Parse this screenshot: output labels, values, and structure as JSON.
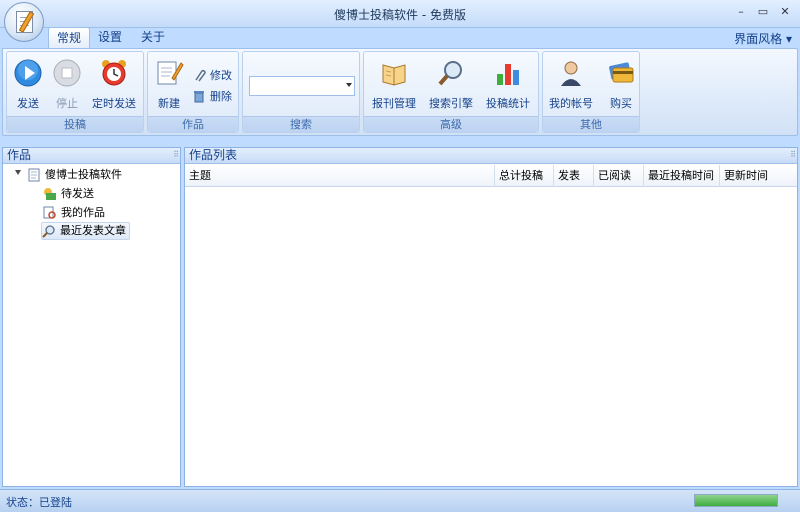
{
  "window": {
    "title": "傻博士投稿软件 - 免费版",
    "controls": {
      "minimize": "–",
      "maximize": "▭",
      "close": "✕"
    }
  },
  "tabs": [
    {
      "label": "常规",
      "active": true
    },
    {
      "label": "设置",
      "active": false
    },
    {
      "label": "关于",
      "active": false
    }
  ],
  "skin_menu": "界面风格 ▾",
  "ribbon": {
    "groups": {
      "submit": {
        "label": "投稿",
        "buttons": [
          {
            "label": "发送",
            "icon": "play-icon",
            "enabled": true
          },
          {
            "label": "停止",
            "icon": "stop-icon",
            "enabled": false
          },
          {
            "label": "定时发送",
            "icon": "alarm-clock-icon",
            "enabled": true
          }
        ]
      },
      "works": {
        "label": "作品",
        "new_label": "新建",
        "edit_label": "修改",
        "delete_label": "删除"
      },
      "search": {
        "label": "搜索",
        "value": ""
      },
      "advanced": {
        "label": "高级",
        "buttons": [
          {
            "label": "报刊管理",
            "icon": "book-icon"
          },
          {
            "label": "搜索引擎",
            "icon": "magnifier-icon"
          },
          {
            "label": "投稿统计",
            "icon": "bar-chart-icon"
          }
        ]
      },
      "other": {
        "label": "其他",
        "buttons": [
          {
            "label": "我的帐号",
            "icon": "user-icon"
          },
          {
            "label": "购买",
            "icon": "credit-card-icon"
          }
        ]
      }
    }
  },
  "left_panel": {
    "title": "作品",
    "tree": {
      "root": "傻博士投稿软件",
      "children": [
        "待发送",
        "我的作品",
        "最近发表文章"
      ],
      "selected": "最近发表文章"
    }
  },
  "right_panel": {
    "title": "作品列表",
    "columns": [
      "主题",
      "总计投稿",
      "发表",
      "已阅读",
      "最近投稿时间",
      "更新时间"
    ],
    "rows": []
  },
  "status": {
    "text": "状态：已登陆",
    "progress": 1.0
  },
  "colors": {
    "accent": "#15428b",
    "background": "#bfdbff",
    "border": "#8db2e3"
  }
}
